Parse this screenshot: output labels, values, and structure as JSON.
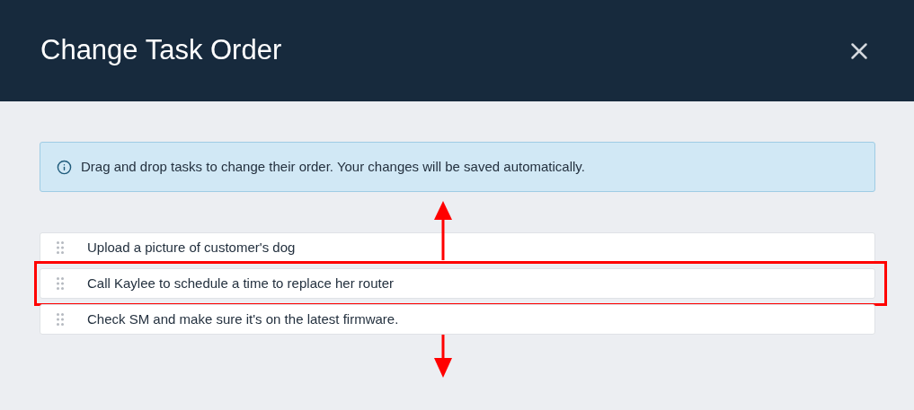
{
  "dialog": {
    "title": "Change Task Order"
  },
  "info": {
    "text": "Drag and drop tasks to change their order. Your changes will be saved automatically."
  },
  "tasks": [
    {
      "label": "Upload a picture of customer's dog",
      "highlighted": false
    },
    {
      "label": "Call Kaylee to schedule a time to replace her router",
      "highlighted": true
    },
    {
      "label": "Check SM and make sure it's on the latest firmware.",
      "highlighted": false
    }
  ]
}
